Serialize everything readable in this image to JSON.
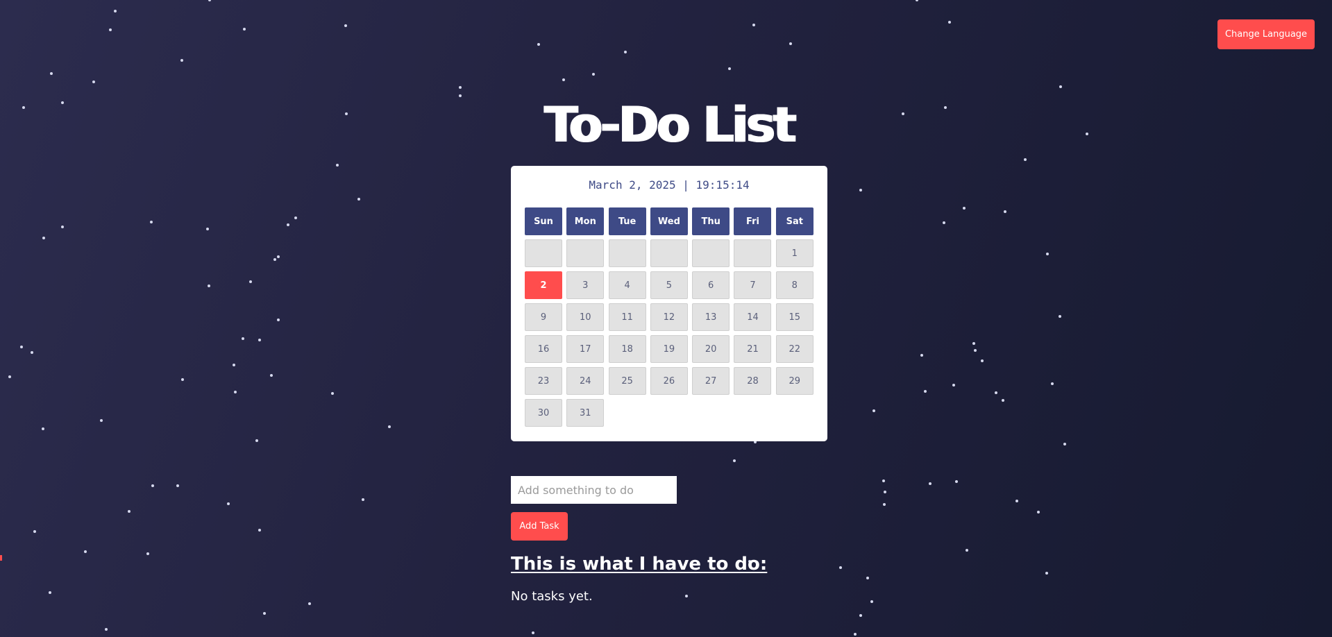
{
  "header": {
    "change_language_label": "Change Language"
  },
  "app": {
    "title": "To-Do List"
  },
  "calendar": {
    "datetime": "March 2, 2025 | 19:15:14",
    "weekdays": [
      "Sun",
      "Mon",
      "Tue",
      "Wed",
      "Thu",
      "Fri",
      "Sat"
    ],
    "leading_blanks": 6,
    "days_in_month": 31,
    "today": 2
  },
  "task_form": {
    "input_value": "",
    "input_placeholder": "Add something to do",
    "add_label": "Add Task"
  },
  "tasks": {
    "heading": "This is what I have to do:",
    "empty_message": "No tasks yet."
  },
  "colors": {
    "accent": "#ff4d4d",
    "calendar_header": "#3e4a86",
    "background_start": "#2c2c4e",
    "background_end": "#161a30"
  }
}
